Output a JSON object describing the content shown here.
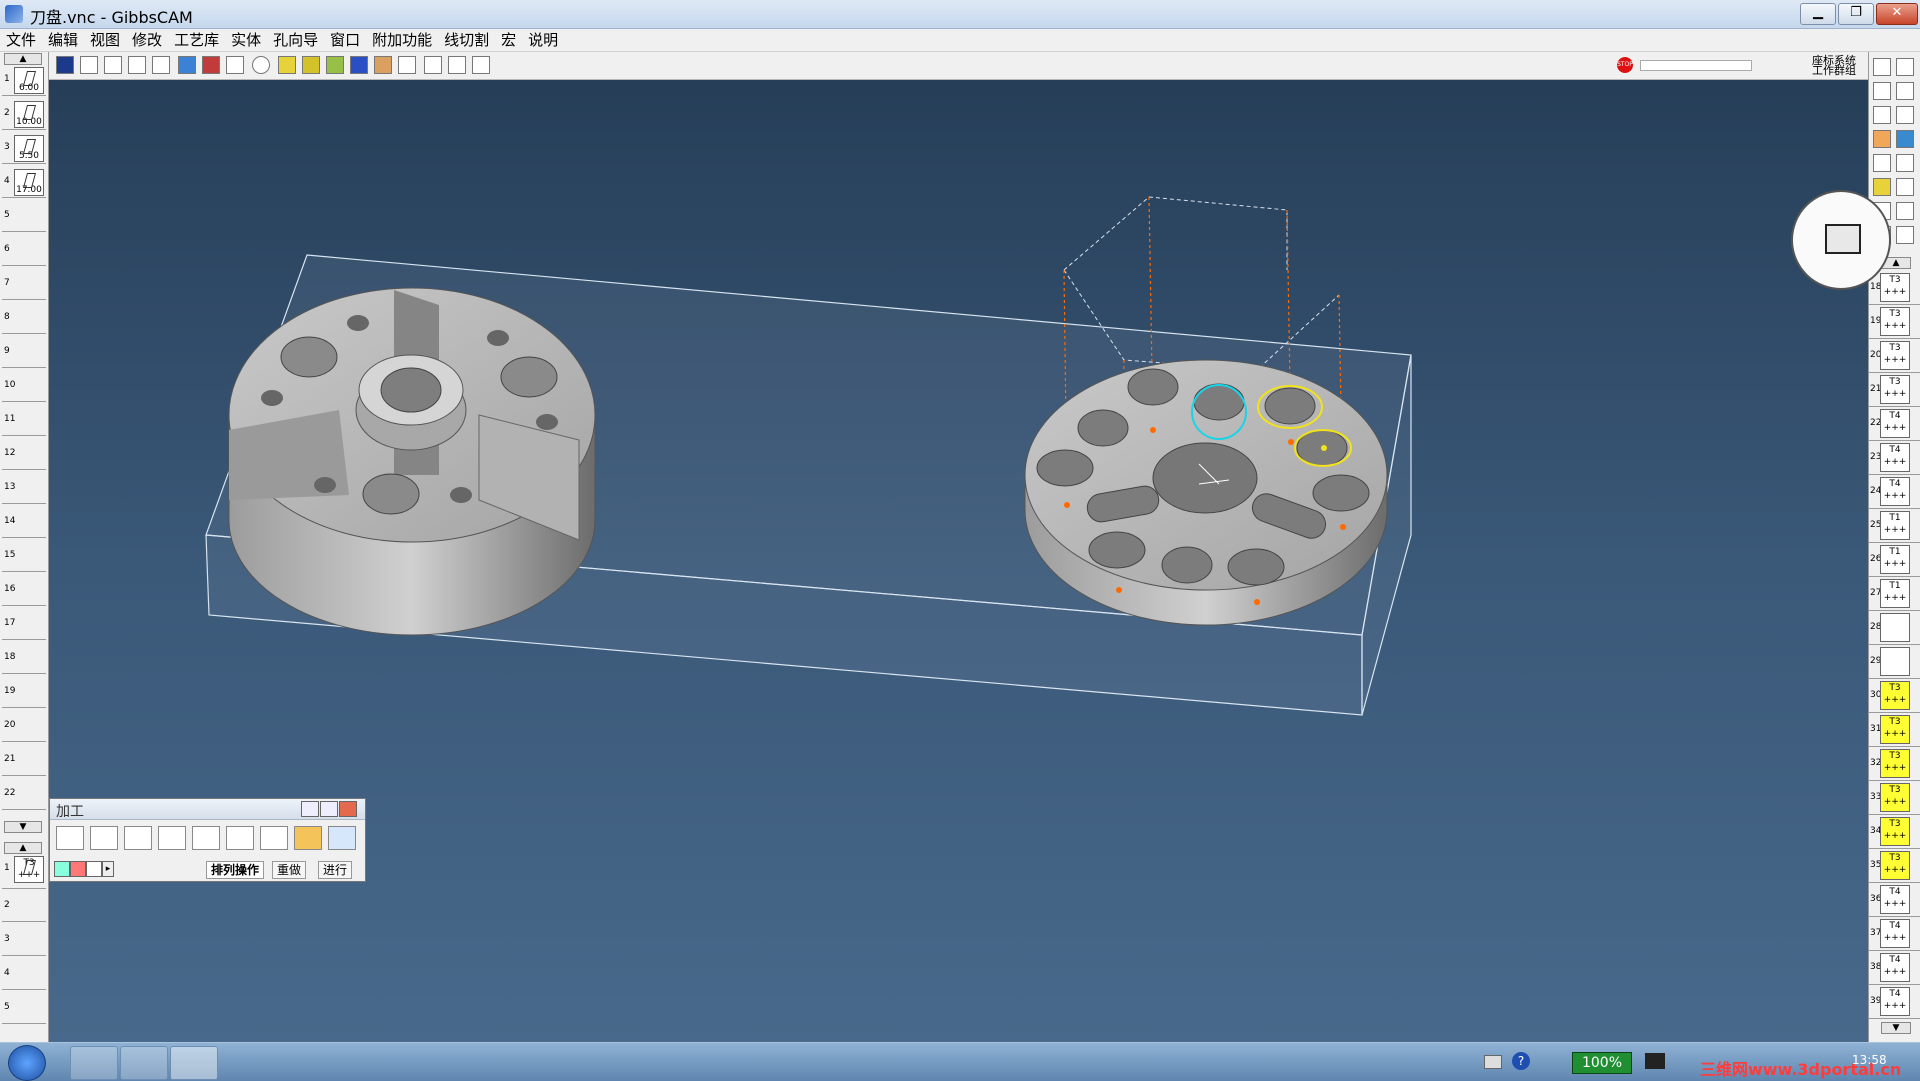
{
  "window": {
    "title": "刀盘.vnc - GibbsCAM"
  },
  "menu": [
    "文件",
    "编辑",
    "视图",
    "修改",
    "工艺库",
    "实体",
    "孔向导",
    "窗口",
    "附加功能",
    "线切割",
    "宏",
    "说明"
  ],
  "coordinate_label": "座标系统\n工作群组",
  "left_tools": [
    {
      "num": "1",
      "label": "6.00"
    },
    {
      "num": "2",
      "label": "10.00"
    },
    {
      "num": "3",
      "label": "5.50"
    },
    {
      "num": "4",
      "label": "17.00"
    }
  ],
  "left_slot_numbers": [
    "5",
    "6",
    "7",
    "8",
    "9",
    "10",
    "11",
    "12",
    "13",
    "14",
    "15",
    "16",
    "17",
    "18",
    "19",
    "20",
    "21",
    "22"
  ],
  "left_lower": {
    "op_num": "1",
    "op_label": "T3",
    "slots": [
      "2",
      "3",
      "4",
      "5"
    ]
  },
  "right_ops": [
    {
      "num": "18",
      "label": "T3"
    },
    {
      "num": "19",
      "label": "T3"
    },
    {
      "num": "20",
      "label": "T3"
    },
    {
      "num": "21",
      "label": "T3"
    },
    {
      "num": "22",
      "label": "T4"
    },
    {
      "num": "23",
      "label": "T4"
    },
    {
      "num": "24",
      "label": "T4"
    },
    {
      "num": "25",
      "label": "T1"
    },
    {
      "num": "26",
      "label": "T1"
    },
    {
      "num": "27",
      "label": "T1"
    },
    {
      "num": "28",
      "label": ""
    },
    {
      "num": "29",
      "label": ""
    },
    {
      "num": "30",
      "label": "T3"
    },
    {
      "num": "31",
      "label": "T3"
    },
    {
      "num": "32",
      "label": "T3"
    },
    {
      "num": "33",
      "label": "T3"
    },
    {
      "num": "34",
      "label": "T3"
    },
    {
      "num": "35",
      "label": "T3"
    },
    {
      "num": "36",
      "label": "T4"
    },
    {
      "num": "37",
      "label": "T4"
    },
    {
      "num": "38",
      "label": "T4"
    },
    {
      "num": "39",
      "label": "T4"
    }
  ],
  "machining_panel": {
    "title": "加工",
    "tabs": [
      "排列操作",
      "重做",
      "进行"
    ]
  },
  "taskbar": {
    "battery": "100%",
    "watermark": "三维网www.3dportal.cn",
    "time": "13:58"
  },
  "colors": {
    "viewport_top": "#263e58",
    "viewport_bottom": "#48698b",
    "highlight_op": "#ffff33",
    "selection_cyan": "#19d4e8",
    "selection_yellow": "#f2e21a",
    "toolpath_orange": "#ff6a00"
  }
}
